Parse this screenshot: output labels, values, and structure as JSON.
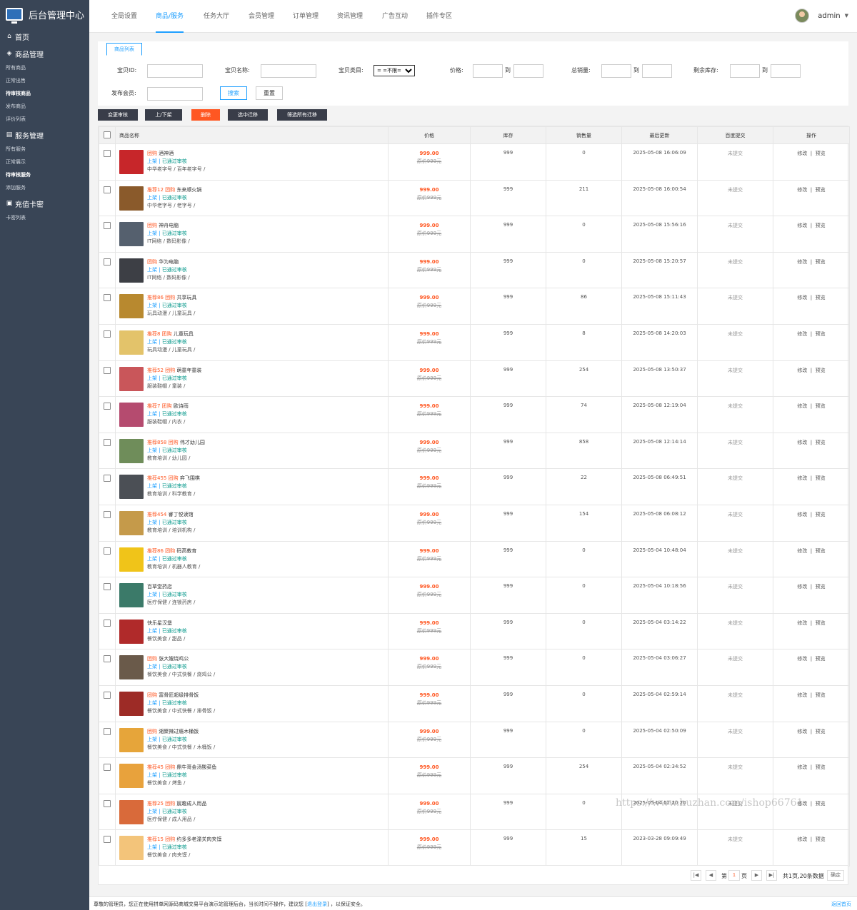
{
  "app": {
    "title": "后台管理中心"
  },
  "sidebar": {
    "home": "首页",
    "groups": [
      {
        "title": "商品管理",
        "icon": "box-icon",
        "items": [
          "所有商品",
          "正常出售",
          "待审核商品",
          "发布商品",
          "评价列表"
        ],
        "active": 2
      },
      {
        "title": "服务管理",
        "icon": "store-icon",
        "items": [
          "所有服务",
          "正常展示",
          "待审核服务",
          "添加服务"
        ],
        "active": 2
      },
      {
        "title": "充值卡密",
        "icon": "card-icon",
        "items": [
          "卡密列表"
        ],
        "active": -1
      }
    ]
  },
  "topnav": {
    "tabs": [
      "全局设置",
      "商品/服务",
      "任务大厅",
      "会员管理",
      "订单管理",
      "资讯管理",
      "广告互动",
      "插件专区"
    ],
    "active": 1
  },
  "user": {
    "name": "admin"
  },
  "page_tab": "商品列表",
  "filter": {
    "id_label": "宝贝ID:",
    "name_label": "宝贝名称:",
    "cat_label": "宝贝类目:",
    "cat_value": "= =不限= =",
    "price_label": "价格:",
    "to": "到",
    "sales_label": "总销量:",
    "stock_label": "剩余库存:",
    "member_label": "发布会员:",
    "search": "搜索",
    "reset": "重置"
  },
  "actions": {
    "audit": "变更审核",
    "onoff": "上/下架",
    "delete": "删除",
    "move_selected": "选中迁移",
    "move_all": "筛选所有迁移"
  },
  "table": {
    "headers": [
      "商品名称",
      "价格",
      "库存",
      "销售量",
      "最后更新",
      "百度提交",
      "操作"
    ],
    "rows": [
      {
        "tags": "团购",
        "name": "酒神酒",
        "cat": "中华老字号 / 百年老字号 /",
        "price": "999.00",
        "orig": "原价999元",
        "stock": "999",
        "sales": "0",
        "updated": "2025-05-08 16:06:09",
        "thumb": "#c7262a"
      },
      {
        "tags": "推荐12 团购",
        "name": "东来顺火锅",
        "cat": "中华老字号 / 老字号 /",
        "price": "999.00",
        "orig": "原价999元",
        "stock": "999",
        "sales": "211",
        "updated": "2025-05-08 16:00:54",
        "thumb": "#8a5a2b"
      },
      {
        "tags": "团购",
        "name": "神舟电脑",
        "cat": "IT网络 / 数码影像 /",
        "price": "999.00",
        "orig": "原价999元",
        "stock": "999",
        "sales": "0",
        "updated": "2025-05-08 15:56:16",
        "thumb": "#55606e"
      },
      {
        "tags": "团购",
        "name": "华为电脑",
        "cat": "IT网络 / 数码影像 /",
        "price": "999.00",
        "orig": "原价999元",
        "stock": "999",
        "sales": "0",
        "updated": "2025-05-08 15:20:57",
        "thumb": "#3d3f45"
      },
      {
        "tags": "推荐86 团购",
        "name": "共享玩具",
        "cat": "玩具动漫 / 儿童玩具 /",
        "price": "999.00",
        "orig": "原价999元",
        "stock": "999",
        "sales": "86",
        "updated": "2025-05-08 15:11:43",
        "thumb": "#b8892f"
      },
      {
        "tags": "推荐8 团购",
        "name": "儿童玩具",
        "cat": "玩具动漫 / 儿童玩具 /",
        "price": "999.00",
        "orig": "原价999元",
        "stock": "999",
        "sales": "8",
        "updated": "2025-05-08 14:20:03",
        "thumb": "#e3c36a"
      },
      {
        "tags": "推荐52 团购",
        "name": "萌童年童装",
        "cat": "服装鞋帽 / 童装 /",
        "price": "999.00",
        "orig": "原价999元",
        "stock": "999",
        "sales": "254",
        "updated": "2025-05-08 13:50:37",
        "thumb": "#c9565a"
      },
      {
        "tags": "推荐7 团购",
        "name": "欧诗雨",
        "cat": "服装鞋帽 / 内衣 /",
        "price": "999.00",
        "orig": "原价999元",
        "stock": "999",
        "sales": "74",
        "updated": "2025-05-08 12:19:04",
        "thumb": "#b54b6f"
      },
      {
        "tags": "推荐858 团购",
        "name": "伟才幼儿园",
        "cat": "教育培训 / 幼儿园 /",
        "price": "999.00",
        "orig": "原价999元",
        "stock": "999",
        "sales": "858",
        "updated": "2025-05-08 12:14:14",
        "thumb": "#6f8d5a"
      },
      {
        "tags": "推荐455 团购",
        "name": "弈飞围棋",
        "cat": "教育培训 / 科学教育 /",
        "price": "999.00",
        "orig": "原价999元",
        "stock": "999",
        "sales": "22",
        "updated": "2025-05-08 06:49:51",
        "thumb": "#4b4f55"
      },
      {
        "tags": "推荐454",
        "name": "睿丁悦读馆",
        "cat": "教育培训 / 培训机构 /",
        "price": "999.00",
        "orig": "原价999元",
        "stock": "999",
        "sales": "154",
        "updated": "2025-05-08 06:08:12",
        "thumb": "#c59a4a"
      },
      {
        "tags": "推荐86 团购",
        "name": "码高教育",
        "cat": "教育培训 / 机器人教育 /",
        "price": "999.00",
        "orig": "原价999元",
        "stock": "999",
        "sales": "0",
        "updated": "2025-05-04 10:48:04",
        "thumb": "#f0c419"
      },
      {
        "tags": "",
        "name": "百草堂药店",
        "cat": "医疗保健 / 连锁药房 /",
        "price": "999.00",
        "orig": "原价999元",
        "stock": "999",
        "sales": "0",
        "updated": "2025-05-04 10:18:56",
        "thumb": "#3b7a69"
      },
      {
        "tags": "",
        "name": "快乐星汉堡",
        "cat": "餐饮美食 / 甜品 /",
        "price": "999.00",
        "orig": "原价999元",
        "stock": "999",
        "sales": "0",
        "updated": "2025-05-04 03:14:22",
        "thumb": "#b02a2a"
      },
      {
        "tags": "团购",
        "name": "张大嫂烧鸡公",
        "cat": "餐饮美食 / 中式快餐 / 烧鸡公 /",
        "price": "999.00",
        "orig": "原价999元",
        "stock": "999",
        "sales": "0",
        "updated": "2025-05-04 03:06:27",
        "thumb": "#6a5a4a"
      },
      {
        "tags": "团购",
        "name": "富骨匠超级排骨饭",
        "cat": "餐饮美食 / 中式快餐 / 排骨饭 /",
        "price": "999.00",
        "orig": "原价999元",
        "stock": "999",
        "sales": "0",
        "updated": "2025-05-04 02:59:14",
        "thumb": "#9d2b26"
      },
      {
        "tags": "团购",
        "name": "湘聚辣过瘾木桶饭",
        "cat": "餐饮美食 / 中式快餐 / 木桶饭 /",
        "price": "999.00",
        "orig": "原价999元",
        "stock": "999",
        "sales": "0",
        "updated": "2025-05-04 02:50:09",
        "thumb": "#e6a53a"
      },
      {
        "tags": "推荐45 团购",
        "name": "鼎牛哥金汤酸菜鱼",
        "cat": "餐饮美食 / 烤鱼 /",
        "price": "999.00",
        "orig": "原价999元",
        "stock": "999",
        "sales": "254",
        "updated": "2025-05-04 02:34:52",
        "thumb": "#e8a23c"
      },
      {
        "tags": "推荐25 团购",
        "name": "宸趣成人用品",
        "cat": "医疗保健 / 成人用品 /",
        "price": "999.00",
        "orig": "原价999元",
        "stock": "999",
        "sales": "0",
        "updated": "2025-05-04 02:20:20",
        "thumb": "#d96a3a"
      },
      {
        "tags": "推荐15 团购",
        "name": "约多多老潼关肉夹馍",
        "cat": "餐饮美食 / 肉夹馍 /",
        "price": "999.00",
        "orig": "原价999元",
        "stock": "999",
        "sales": "15",
        "updated": "2023-03-28 09:09:49",
        "thumb": "#f3c47a"
      }
    ],
    "status_on": "上架",
    "status_sep": " | ",
    "status_ok": "已通过审核",
    "baidu": "未提交",
    "op_edit": "修改",
    "op_preview": "预览"
  },
  "pager": {
    "prefix": "第",
    "page": "1",
    "suffix": "页",
    "summary": "共1页,20条数据",
    "confirm": "确定"
  },
  "footer": {
    "text": "尊敬的管理员，您正在使用拼单网源码商城交易平台演示站管理后台，当长时间不操作，建议您 [",
    "logout": "退出登录",
    "text2": "] ，以保证安全。",
    "back": "返回首页"
  },
  "watermark": "https://www.huzhan.com/ishop66761"
}
